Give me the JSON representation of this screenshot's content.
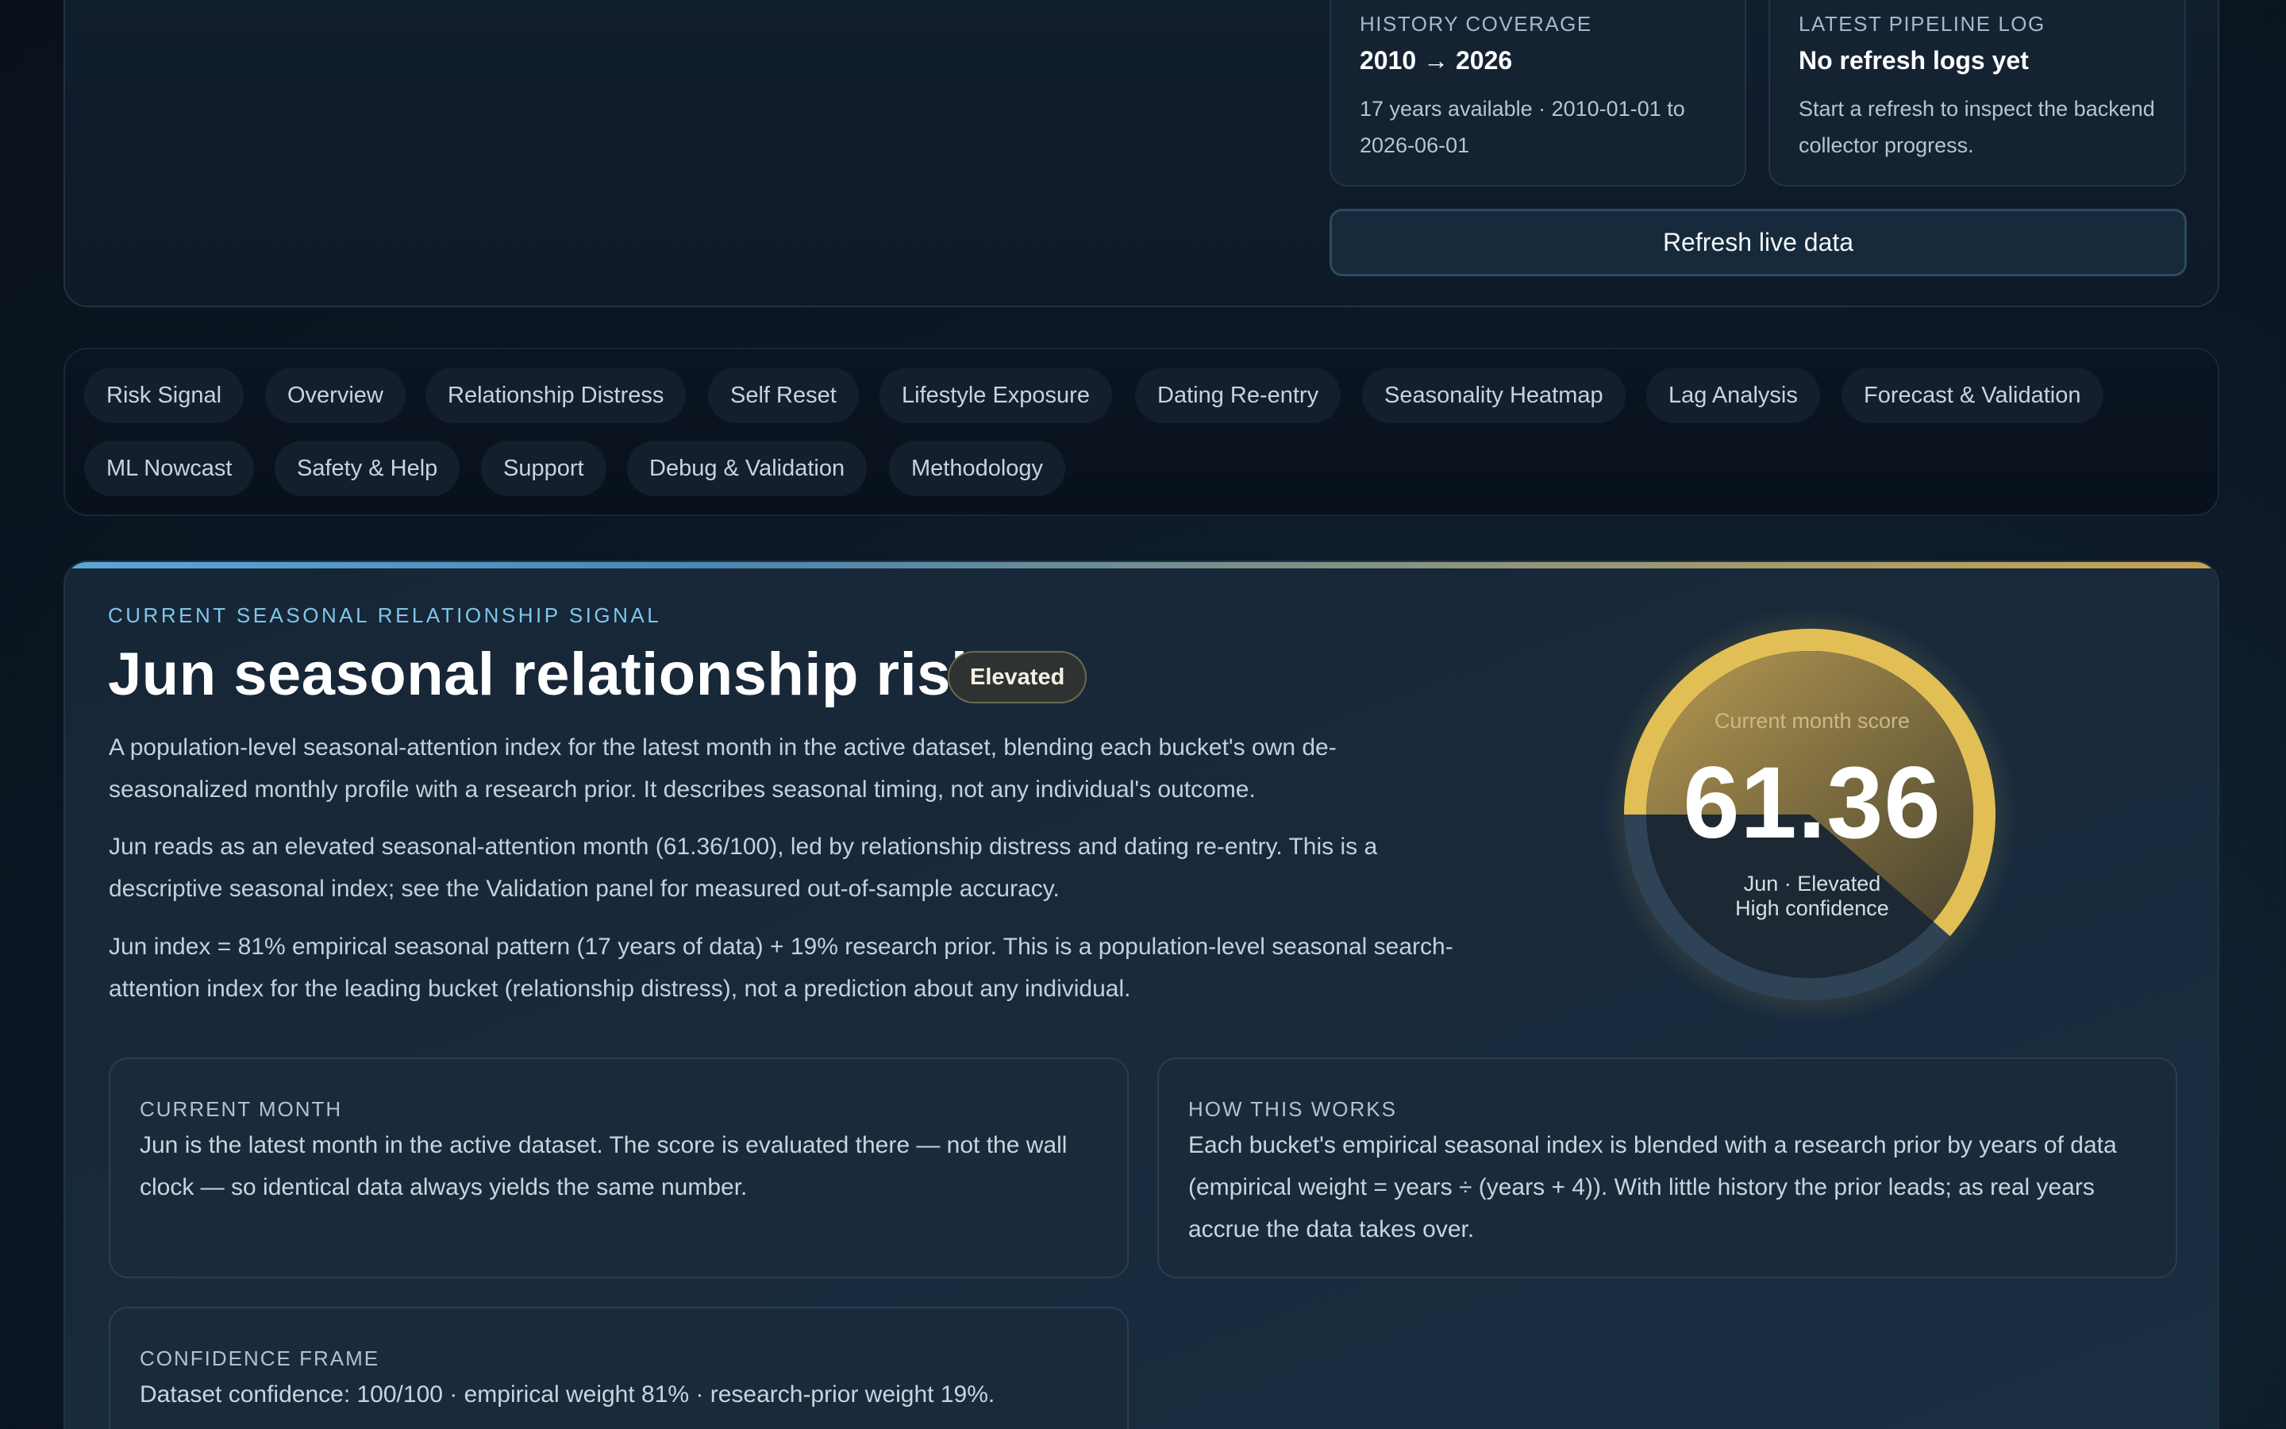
{
  "top_panel": {
    "history_card": {
      "kicker": "HISTORY COVERAGE",
      "title": "2010 → 2026",
      "body": "17 years available · 2010-01-01 to 2026-06-01"
    },
    "pipeline_card": {
      "kicker": "LATEST PIPELINE LOG",
      "title": "No refresh logs yet",
      "body": "Start a refresh to inspect the backend collector progress."
    },
    "refresh_button_label": "Refresh live data"
  },
  "nav": {
    "tabs": [
      {
        "label": "Risk Signal"
      },
      {
        "label": "Overview"
      },
      {
        "label": "Relationship Distress"
      },
      {
        "label": "Self Reset"
      },
      {
        "label": "Lifestyle Exposure"
      },
      {
        "label": "Dating Re-entry"
      },
      {
        "label": "Seasonality Heatmap"
      },
      {
        "label": "Lag Analysis"
      },
      {
        "label": "Forecast & Validation"
      },
      {
        "label": "ML Nowcast"
      },
      {
        "label": "Safety & Help"
      },
      {
        "label": "Support"
      },
      {
        "label": "Debug & Validation"
      },
      {
        "label": "Methodology"
      }
    ]
  },
  "signal": {
    "kicker": "CURRENT SEASONAL RELATIONSHIP SIGNAL",
    "title": "Jun seasonal relationship risk",
    "badge": "Elevated",
    "paragraphs": [
      "A population-level seasonal-attention index for the latest month in the active dataset, blending each bucket's own de-seasonalized monthly profile with a research prior. It describes seasonal timing, not any individual's outcome.",
      "Jun reads as an elevated seasonal-attention month (61.36/100), led by relationship distress and dating re-entry. This is a descriptive seasonal index; see the Validation panel for measured out-of-sample accuracy.",
      "Jun index = 81% empirical seasonal pattern (17 years of data) + 19% research prior. This is a population-level seasonal search-attention index for the leading bucket (relationship distress), not a prediction about any individual."
    ]
  },
  "gauge": {
    "label": "Current month score",
    "value": "61.36",
    "score": 61.36,
    "max": 100,
    "sub1": "Jun · Elevated",
    "sub2": "High confidence",
    "color": "#e2bf55"
  },
  "cards": {
    "current_month": {
      "kicker": "CURRENT MONTH",
      "body": "Jun is the latest month in the active dataset. The score is evaluated there — not the wall clock — so identical data always yields the same number."
    },
    "how_it_works": {
      "kicker": "HOW THIS WORKS",
      "body": "Each bucket's empirical seasonal index is blended with a research prior by years of data (empirical weight = years ÷ (years + 4)). With little history the prior leads; as real years accrue the data takes over."
    },
    "confidence": {
      "kicker": "CONFIDENCE FRAME",
      "body": "Dataset confidence: 100/100 · empirical weight 81% · research-prior weight 19%."
    }
  },
  "colors": {
    "accent_blue": "#7fc7ea",
    "accent_gold": "#e2bf55",
    "background": "#0c1724"
  }
}
